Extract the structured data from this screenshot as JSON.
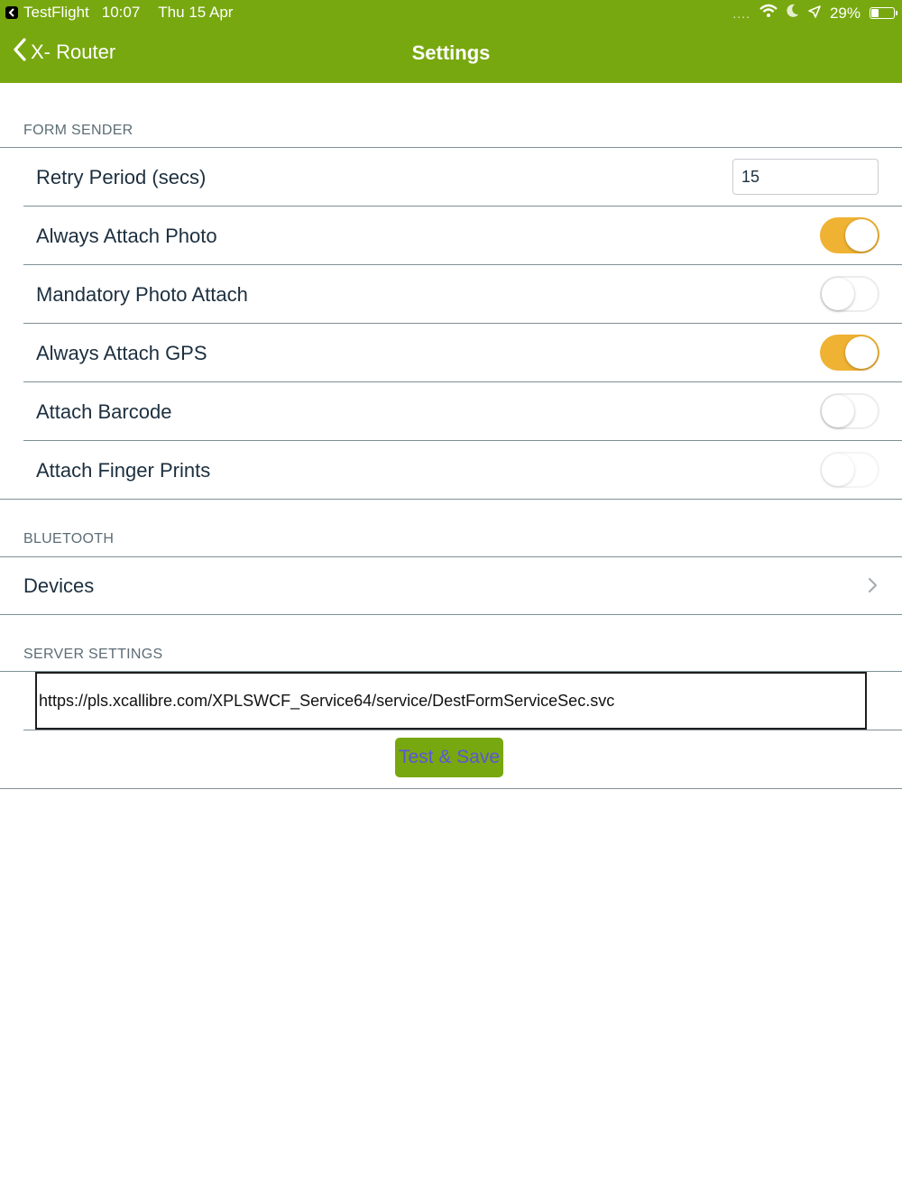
{
  "status_bar": {
    "app": "TestFlight",
    "time": "10:07",
    "date": "Thu 15 Apr",
    "signal": "....",
    "battery": "29%",
    "battery_level": 0.29
  },
  "nav": {
    "back_label": "X- Router",
    "title": "Settings"
  },
  "form_sender": {
    "header": "FORM SENDER",
    "retry_label": "Retry Period (secs)",
    "retry_value": "15",
    "toggles": [
      {
        "label": "Always Attach Photo",
        "on": true
      },
      {
        "label": "Mandatory Photo Attach",
        "on": false
      },
      {
        "label": "Always Attach GPS",
        "on": true
      },
      {
        "label": "Attach Barcode",
        "on": false
      },
      {
        "label": "Attach Finger Prints",
        "on": false,
        "disabled": true
      }
    ]
  },
  "bluetooth": {
    "header": "BLUETOOTH",
    "devices_label": "Devices"
  },
  "server": {
    "header": "SERVER SETTINGS",
    "url": "https://pls.xcallibre.com/XPLSWCF_Service64/service/DestFormServiceSec.svc",
    "button_label": "Test & Save"
  },
  "colors": {
    "accent_green": "#78a80f",
    "toggle_on": "#f0b232",
    "button_text": "#5b56d9"
  }
}
